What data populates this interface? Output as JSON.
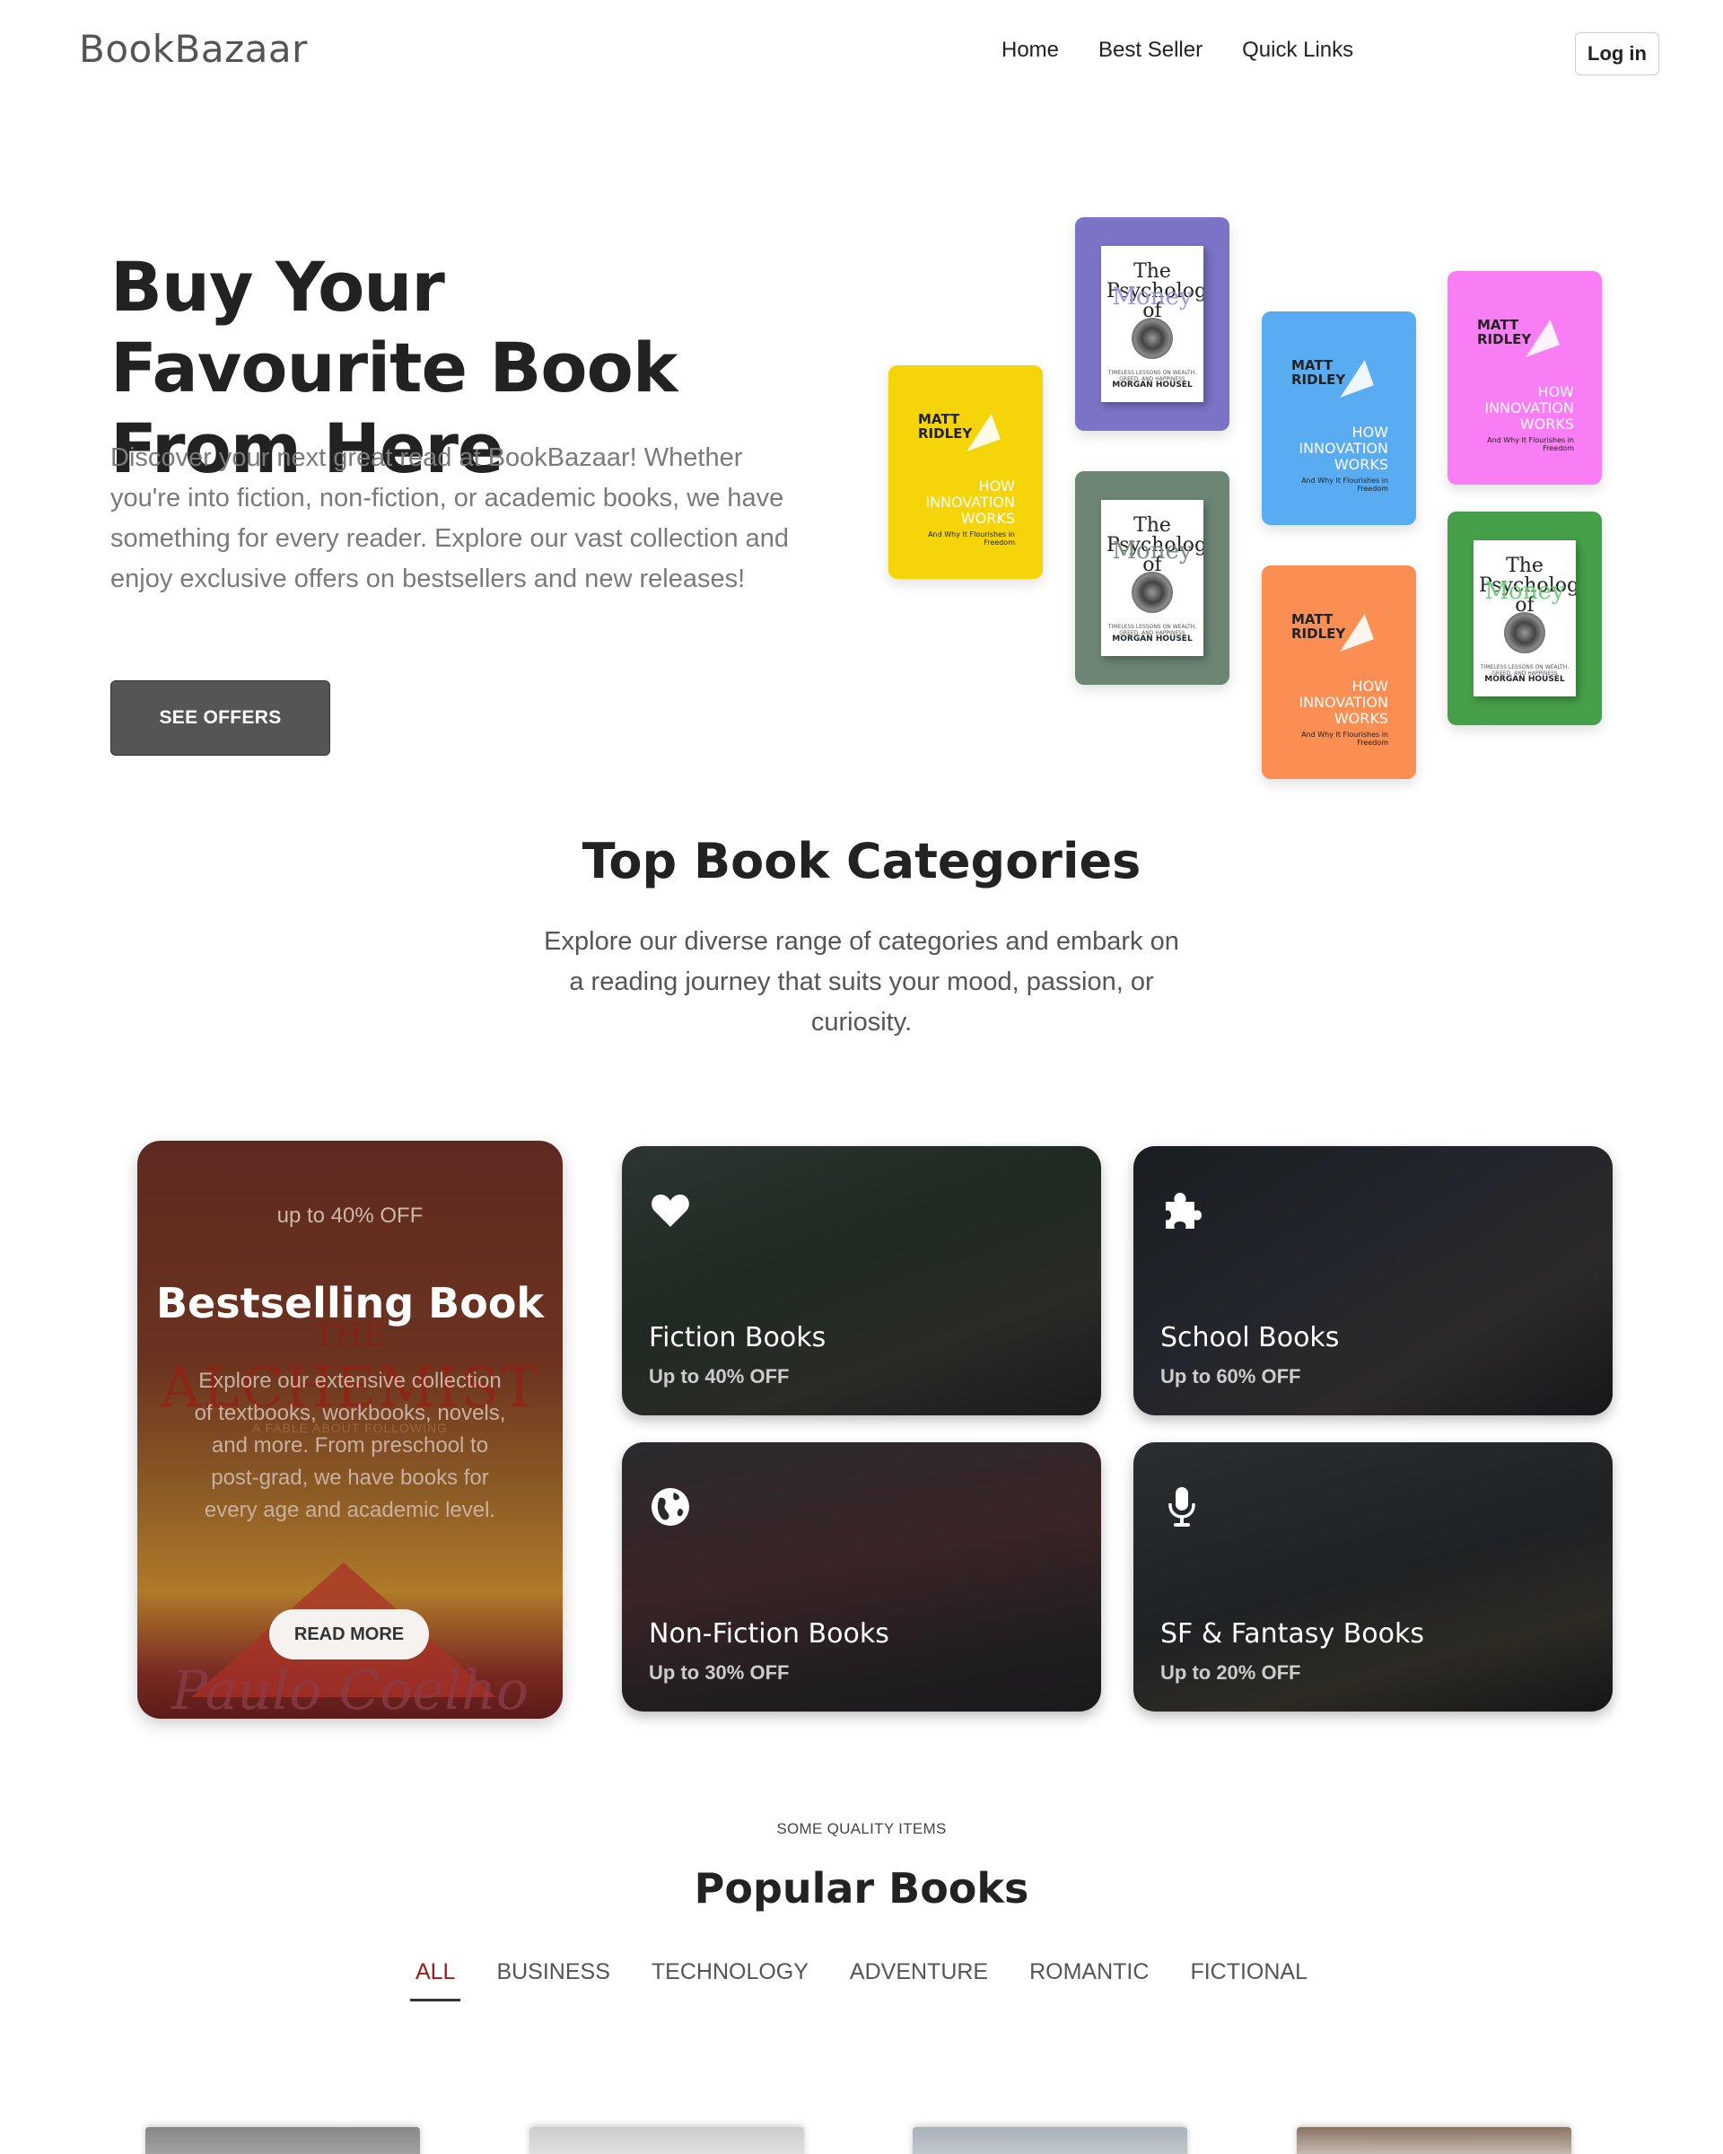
{
  "header": {
    "brand": "BookBazaar",
    "nav": [
      "Home",
      "Best Seller",
      "Quick Links"
    ],
    "login_label": "Log in"
  },
  "hero": {
    "title": "Buy Your Favourite Book From Here",
    "description": "Discover your next great read at BookBazaar! Whether you're into fiction, non-fiction, or academic books, we have something for every reader. Explore our vast collection and enjoy exclusive offers on bestsellers and new releases!",
    "cta": "SEE OFFERS",
    "books": [
      {
        "kind": "innovation",
        "color": "#f6d40a",
        "author": "MATT RIDLEY",
        "title": "HOW INNOVATION WORKS",
        "subtitle": "And Why It Flourishes in Freedom"
      },
      {
        "kind": "psychology",
        "color": "#7a73c6",
        "title": "The Psychology of",
        "money": "Money",
        "money_color": "#9a98e0",
        "subtitle": "TIMELESS LESSONS ON WEALTH, GREED, AND HAPPINESS",
        "author": "MORGAN HOUSEL"
      },
      {
        "kind": "psychology",
        "color": "#6c8574",
        "title": "The Psychology of",
        "money": "Money",
        "money_color": "#7a8e80",
        "subtitle": "TIMELESS LESSONS ON WEALTH, GREED, AND HAPPINESS",
        "author": "MORGAN HOUSEL"
      },
      {
        "kind": "innovation",
        "color": "#5aacf2",
        "author": "MATT RIDLEY",
        "title": "HOW INNOVATION WORKS",
        "subtitle": "And Why It Flourishes in Freedom"
      },
      {
        "kind": "innovation",
        "color": "#fb8e52",
        "author": "MATT RIDLEY",
        "title": "HOW INNOVATION WORKS",
        "subtitle": "And Why It Flourishes in Freedom"
      },
      {
        "kind": "innovation",
        "color": "#f97ef5",
        "author": "MATT RIDLEY",
        "title": "HOW INNOVATION WORKS",
        "subtitle": "And Why It Flourishes in Freedom"
      },
      {
        "kind": "psychology",
        "color": "#46a04a",
        "title": "The Psychology of",
        "money": "Money",
        "money_color": "#6bd078",
        "subtitle": "TIMELESS LESSONS ON WEALTH, GREED, AND HAPPINESS",
        "author": "MORGAN HOUSEL"
      }
    ]
  },
  "categories": {
    "title": "Top Book Categories",
    "description": "Explore our diverse range of categories and embark on a reading journey that suits your mood, passion, or curiosity.",
    "featured": {
      "offer": "up to 40% OFF",
      "title": "Bestselling Book",
      "description": "Explore our extensive collection of textbooks, workbooks, novels, and more. From preschool to post-grad, we have books for every age and academic level.",
      "cta": "READ MORE",
      "cover": {
        "title_top": "THE",
        "title_main": "ALCHEMIST",
        "tagline": "A FABLE ABOUT FOLLOWING",
        "signature": "Paulo Coelho"
      }
    },
    "tiles": [
      {
        "name": "Fiction Books",
        "discount": "Up to 40% OFF",
        "icon": "heart-icon"
      },
      {
        "name": "School Books",
        "discount": "Up to 60% OFF",
        "icon": "puzzle-icon"
      },
      {
        "name": "Non-Fiction Books",
        "discount": "Up to 30% OFF",
        "icon": "globe-icon"
      },
      {
        "name": "SF & Fantasy Books",
        "discount": "Up to 20% OFF",
        "icon": "microphone-icon"
      }
    ]
  },
  "popular": {
    "kicker": "SOME QUALITY ITEMS",
    "title": "Popular Books",
    "tabs": [
      "ALL",
      "BUSINESS",
      "TECHNOLOGY",
      "ADVENTURE",
      "ROMANTIC",
      "FICTIONAL"
    ],
    "active_tab": "ALL"
  },
  "colors": {
    "accent": "#9b1b1b",
    "button_dark": "#555555"
  }
}
